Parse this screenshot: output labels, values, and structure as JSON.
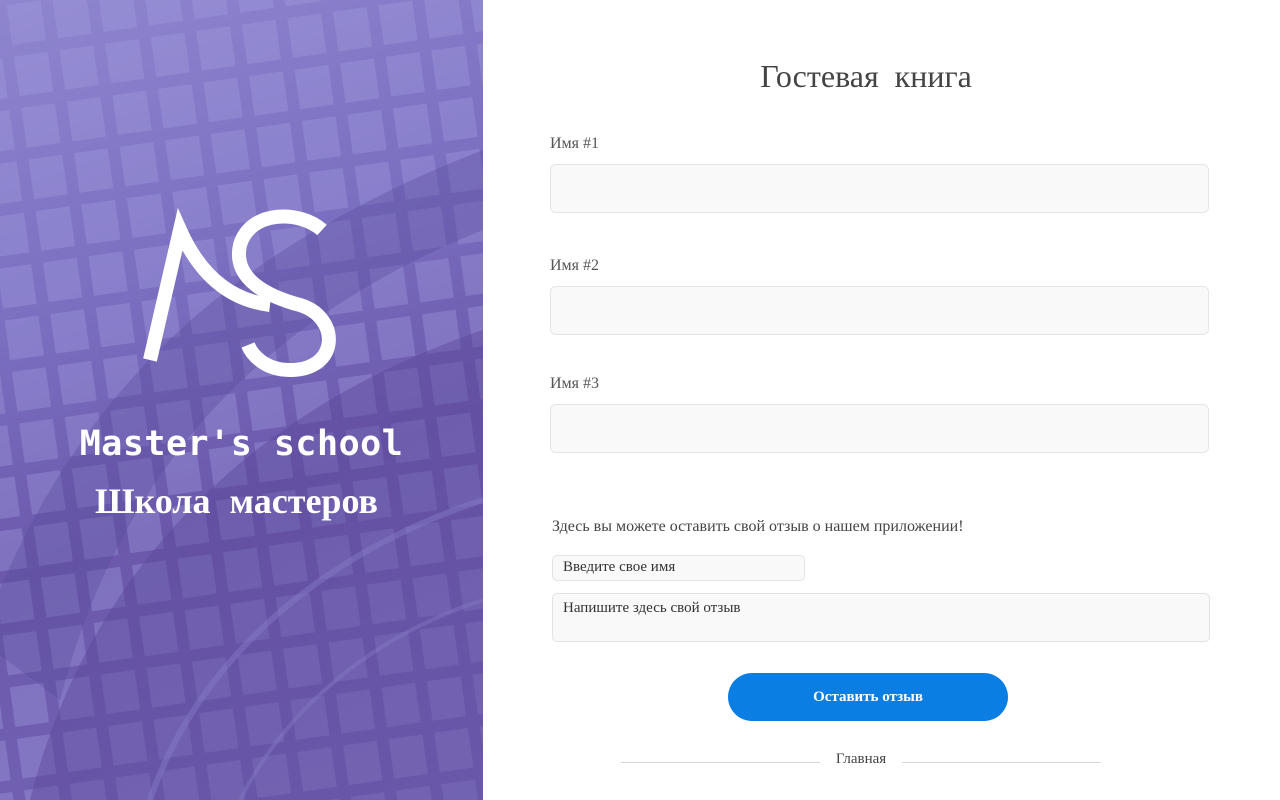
{
  "brand": {
    "name_en": "Master's school",
    "name_ru": "Школа  мастеров",
    "logo_icon": "ms-logo-icon"
  },
  "guestbook": {
    "title": "Гостевая  книга",
    "fields": [
      {
        "label": "Имя #1",
        "value": ""
      },
      {
        "label": "Имя #2",
        "value": ""
      },
      {
        "label": "Имя #3",
        "value": ""
      }
    ]
  },
  "review": {
    "hint": "Здесь вы можете оставить свой отзыв о нашем приложении!",
    "name_placeholder": "Введите свое имя",
    "text_placeholder": "Напишите здесь свой отзыв",
    "submit_label": "Оставить отзыв"
  },
  "footer": {
    "home_label": "Главная"
  },
  "colors": {
    "accent": "#0b7ee3",
    "panel": "#6b58ab"
  }
}
